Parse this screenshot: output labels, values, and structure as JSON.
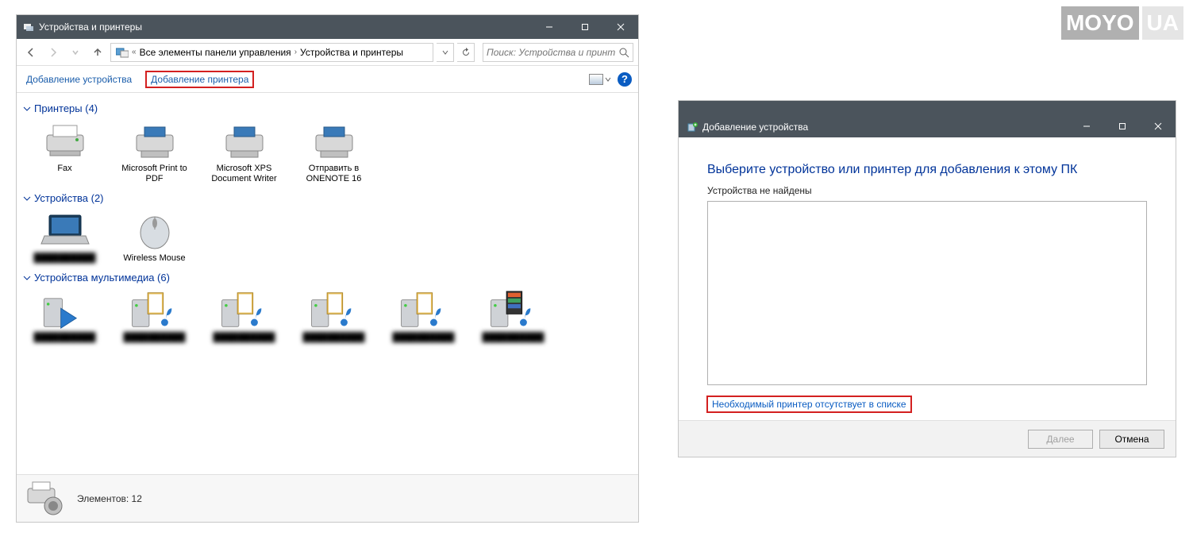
{
  "logo": {
    "part1": "MOYO",
    "part2": "UA"
  },
  "win1": {
    "title": "Устройства и принтеры",
    "breadcrumb": {
      "prefix": "«",
      "item1": "Все элементы панели управления",
      "item2": "Устройства и принтеры"
    },
    "search_placeholder": "Поиск: Устройства и принте...",
    "toolbar": {
      "add_device": "Добавление устройства",
      "add_printer": "Добавление принтера"
    },
    "groups": {
      "printers": {
        "label": "Принтеры (4)",
        "items": [
          {
            "label": "Fax"
          },
          {
            "label": "Microsoft Print to PDF"
          },
          {
            "label": "Microsoft XPS Document Writer"
          },
          {
            "label": "Отправить в ONENOTE 16"
          }
        ]
      },
      "devices": {
        "label": "Устройства (2)",
        "items": [
          {
            "label": "██████████"
          },
          {
            "label": "Wireless Mouse"
          }
        ]
      },
      "multimedia": {
        "label": "Устройства мультимедиа (6)",
        "items": [
          {
            "label": "██████████"
          },
          {
            "label": "██████████"
          },
          {
            "label": "██████████"
          },
          {
            "label": "██████████"
          },
          {
            "label": "██████████"
          },
          {
            "label": "██████████"
          }
        ]
      }
    },
    "status": {
      "text": "Элементов: 12"
    }
  },
  "win2": {
    "title": "Добавление устройства",
    "heading": "Выберите устройство или принтер для добавления к этому ПК",
    "sub": "Устройства не найдены",
    "missing_link": "Необходимый принтер отсутствует в списке",
    "btn_next": "Далее",
    "btn_cancel": "Отмена"
  }
}
